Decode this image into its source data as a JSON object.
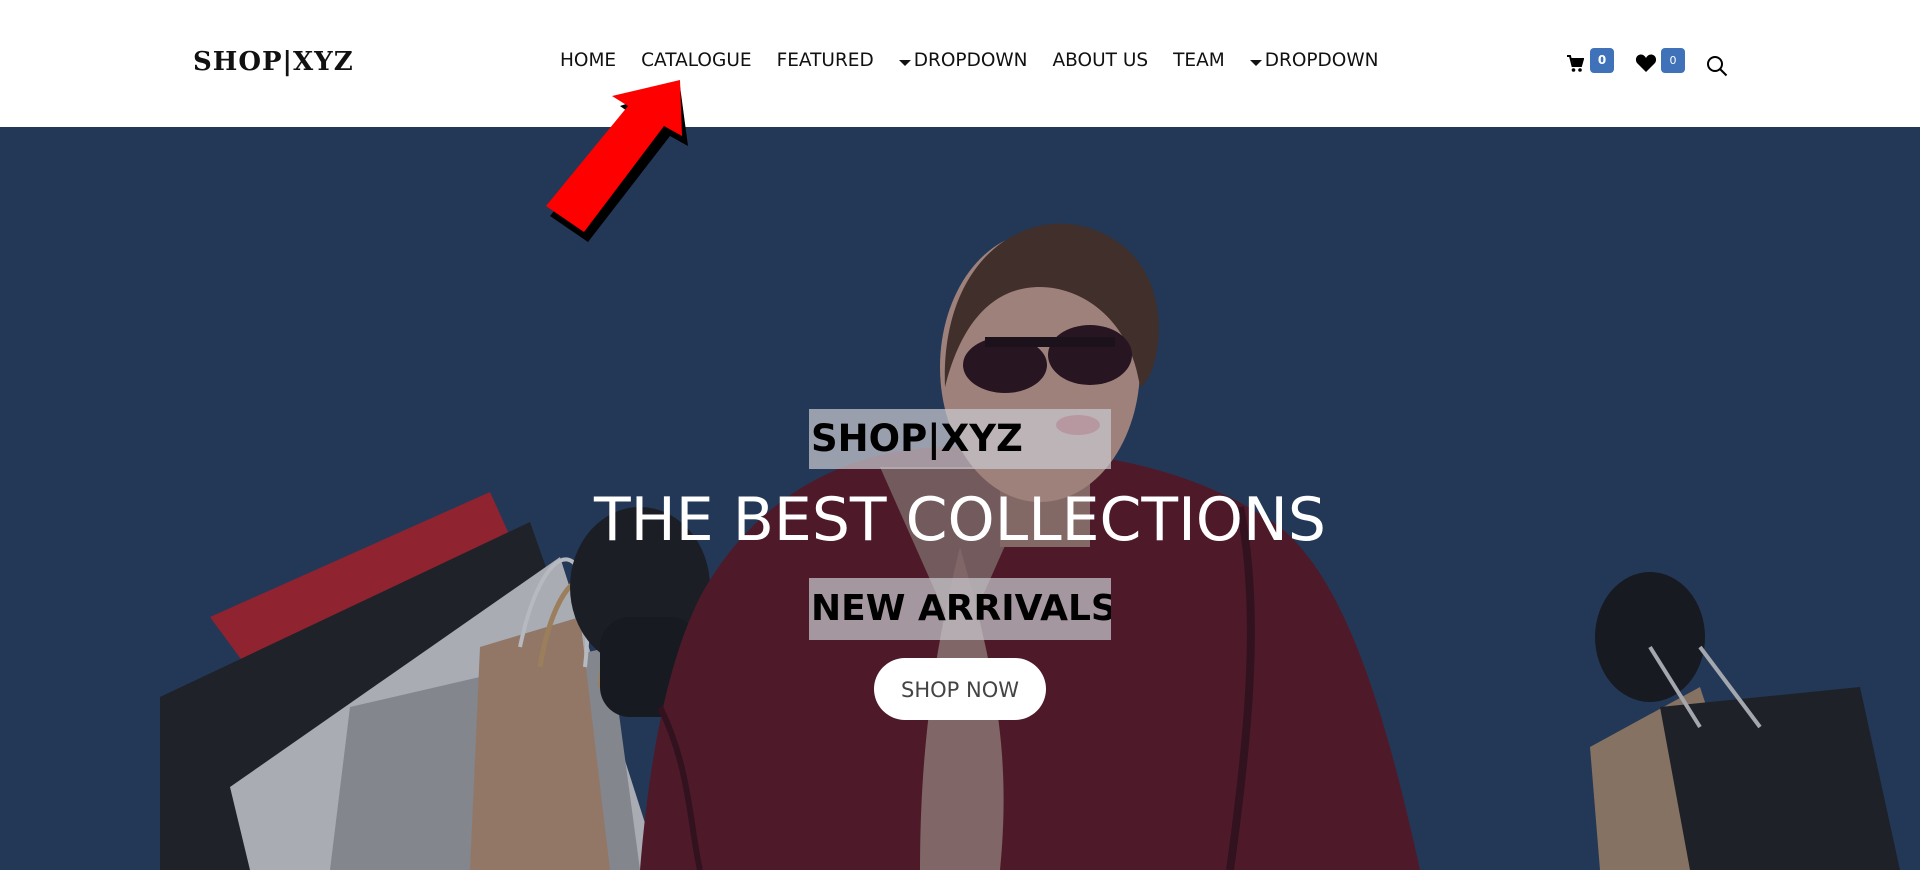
{
  "header": {
    "logo": "SHOP|XYZ",
    "nav": [
      {
        "label": "HOME",
        "has_caret": false
      },
      {
        "label": "CATALOGUE",
        "has_caret": false
      },
      {
        "label": "FEATURED",
        "has_caret": false
      },
      {
        "label": "DROPDOWN",
        "has_caret": true
      },
      {
        "label": "ABOUT US",
        "has_caret": false
      },
      {
        "label": "TEAM",
        "has_caret": false
      },
      {
        "label": "DROPDOWN",
        "has_caret": true
      }
    ],
    "icons": {
      "cart": {
        "icon": "cart-icon",
        "count": "0"
      },
      "wishlist": {
        "icon": "heart-icon",
        "count": "0"
      },
      "search": {
        "icon": "search-icon"
      }
    }
  },
  "hero": {
    "brand": "SHOP|XYZ",
    "title": "THE BEST COLLECTIONS",
    "subtitle": "NEW ARRIVALS",
    "button_label": "SHOP NOW"
  },
  "annotation": {
    "arrow_color": "#ff0000",
    "points_to": "CATALOGUE"
  },
  "colors": {
    "hero_background": "#243c5c",
    "badge": "#3f72b8",
    "text_dark": "#111111"
  }
}
